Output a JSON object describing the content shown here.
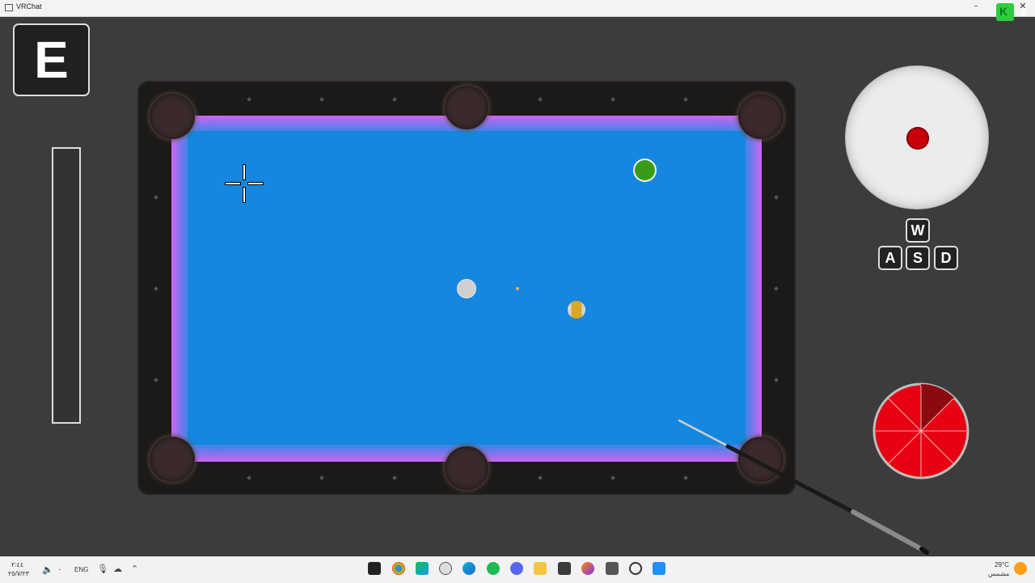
{
  "window": {
    "title": "VRChat",
    "overlay_count": "2"
  },
  "hud": {
    "interact_key": "E",
    "power_level": 0,
    "movement_keys": {
      "w": "W",
      "a": "A",
      "s": "S",
      "d": "D"
    },
    "spin_indicator": "center-top",
    "angle_wheel_sectors": 8
  },
  "table": {
    "felt_color": "#1a8ee8",
    "rail_glow_color": "#ff5cf0",
    "balls": [
      {
        "name": "green-ball",
        "color": "#3a9b18"
      },
      {
        "name": "cue-ball",
        "color": "#cfcfcf"
      },
      {
        "name": "striped-ball",
        "color": "#d9a82a"
      }
    ]
  },
  "taskbar": {
    "time": "٢:٤٤",
    "date": "٢٥/٧/٢٣",
    "language": "ENG",
    "temperature": "29°C",
    "weather": "مشمس"
  }
}
